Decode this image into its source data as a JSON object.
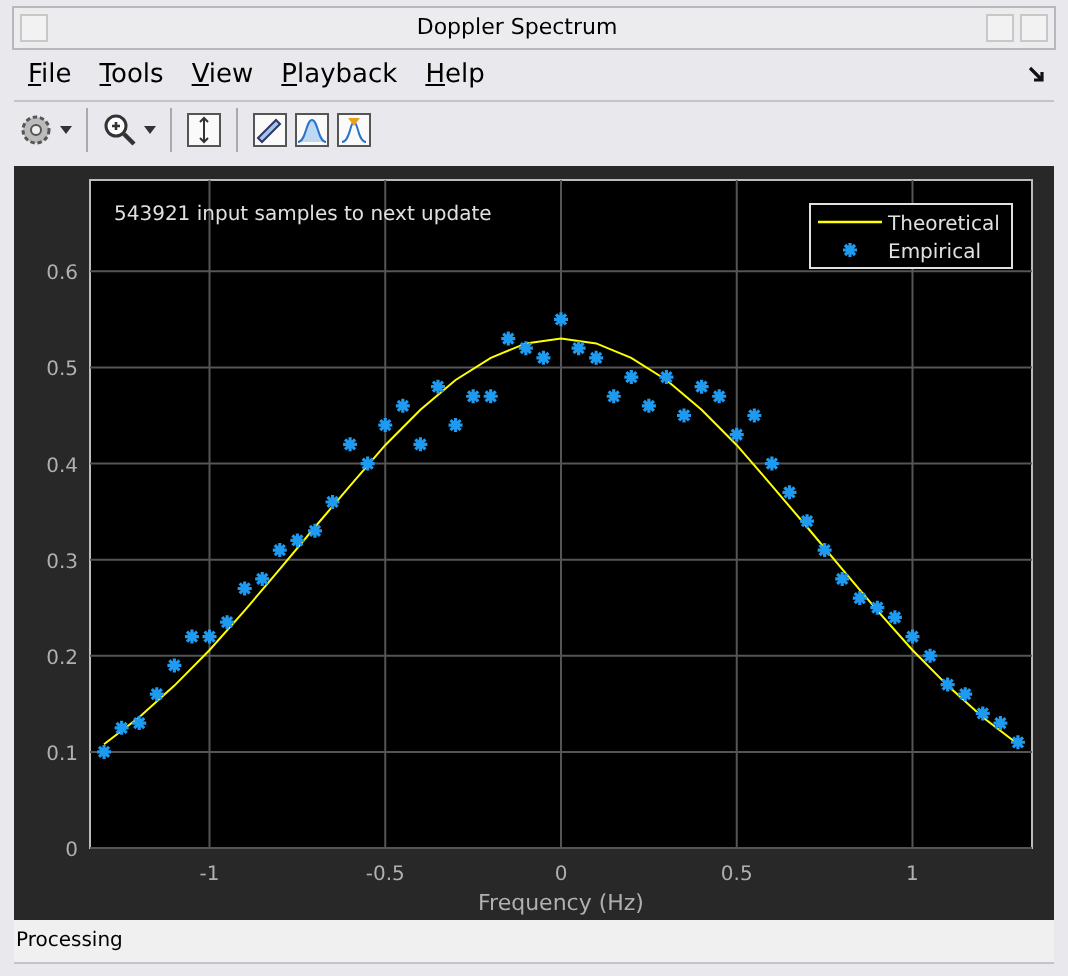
{
  "window": {
    "title": "Doppler Spectrum"
  },
  "menu": [
    {
      "label": "File"
    },
    {
      "label": "Tools"
    },
    {
      "label": "View"
    },
    {
      "label": "Playback"
    },
    {
      "label": "Help"
    }
  ],
  "chart_data": {
    "type": "line",
    "xlabel": "Frequency (Hz)",
    "xlim": [
      -1.34,
      1.34
    ],
    "ylim": [
      0,
      0.695
    ],
    "xticks": [
      -1,
      -0.5,
      0,
      0.5,
      1
    ],
    "yticks": [
      0,
      0.1,
      0.2,
      0.3,
      0.4,
      0.5,
      0.6
    ],
    "annotations": [
      "543921 input samples to next update"
    ],
    "grid": true,
    "legend": true,
    "series": [
      {
        "name": "Theoretical",
        "type": "line",
        "color": "#ffff00",
        "x": [
          -1.3,
          -1.2,
          -1.1,
          -1.0,
          -0.9,
          -0.8,
          -0.7,
          -0.6,
          -0.5,
          -0.4,
          -0.3,
          -0.2,
          -0.1,
          0,
          0.1,
          0.2,
          0.3,
          0.4,
          0.5,
          0.6,
          0.7,
          0.8,
          0.9,
          1.0,
          1.1,
          1.2,
          1.3
        ],
        "values": [
          0.108,
          0.136,
          0.169,
          0.206,
          0.247,
          0.29,
          0.334,
          0.377,
          0.419,
          0.456,
          0.487,
          0.51,
          0.525,
          0.53,
          0.525,
          0.51,
          0.487,
          0.456,
          0.419,
          0.377,
          0.334,
          0.29,
          0.247,
          0.206,
          0.169,
          0.136,
          0.108
        ]
      },
      {
        "name": "Empirical",
        "type": "scatter",
        "color": "#1e9bf0",
        "x": [
          -1.3,
          -1.25,
          -1.2,
          -1.15,
          -1.1,
          -1.05,
          -1.0,
          -0.95,
          -0.9,
          -0.85,
          -0.8,
          -0.75,
          -0.7,
          -0.65,
          -0.6,
          -0.55,
          -0.5,
          -0.45,
          -0.4,
          -0.35,
          -0.3,
          -0.25,
          -0.2,
          -0.15,
          -0.1,
          -0.05,
          0,
          0.05,
          0.1,
          0.15,
          0.2,
          0.25,
          0.3,
          0.35,
          0.4,
          0.45,
          0.5,
          0.55,
          0.6,
          0.65,
          0.7,
          0.75,
          0.8,
          0.85,
          0.9,
          0.95,
          1.0,
          1.05,
          1.1,
          1.15,
          1.2,
          1.25,
          1.3
        ],
        "values": [
          0.1,
          0.125,
          0.13,
          0.16,
          0.19,
          0.22,
          0.22,
          0.235,
          0.27,
          0.28,
          0.31,
          0.32,
          0.33,
          0.36,
          0.42,
          0.4,
          0.44,
          0.46,
          0.42,
          0.48,
          0.44,
          0.47,
          0.47,
          0.53,
          0.52,
          0.51,
          0.55,
          0.52,
          0.51,
          0.47,
          0.49,
          0.46,
          0.49,
          0.45,
          0.48,
          0.47,
          0.43,
          0.45,
          0.4,
          0.37,
          0.34,
          0.31,
          0.28,
          0.26,
          0.25,
          0.24,
          0.22,
          0.2,
          0.17,
          0.16,
          0.14,
          0.13,
          0.11
        ]
      }
    ]
  },
  "status_bar": {
    "text": "Processing"
  }
}
